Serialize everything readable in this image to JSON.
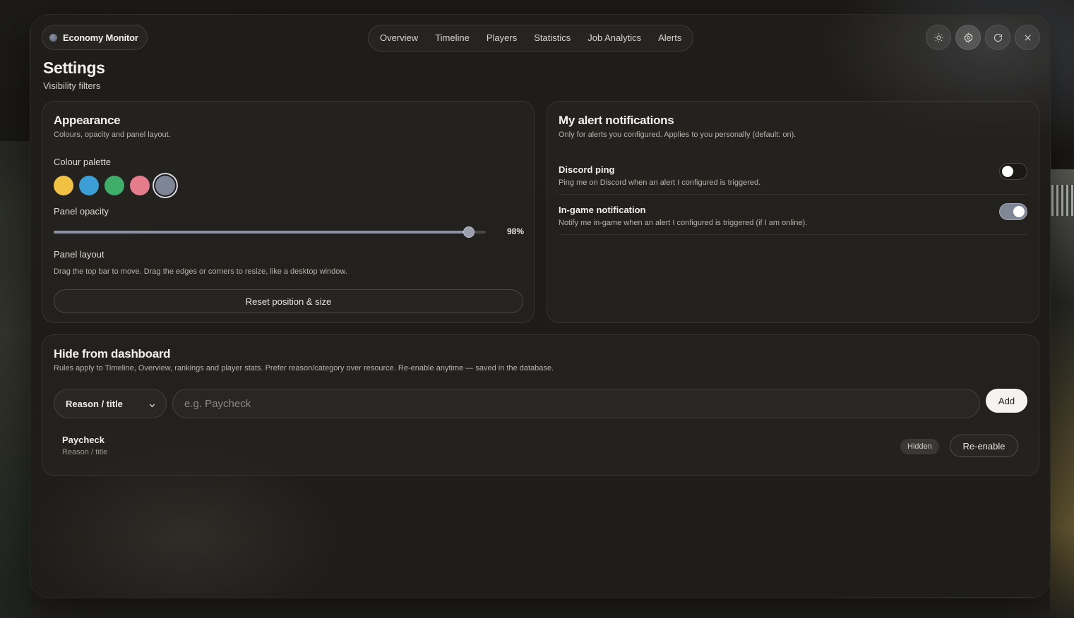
{
  "brand": {
    "label": "Economy Monitor"
  },
  "nav": {
    "tabs": [
      {
        "label": "Overview"
      },
      {
        "label": "Timeline"
      },
      {
        "label": "Players"
      },
      {
        "label": "Statistics"
      },
      {
        "label": "Job Analytics"
      },
      {
        "label": "Alerts"
      }
    ]
  },
  "toolbar": {
    "icons": [
      "sun-icon",
      "gear-icon",
      "refresh-icon",
      "close-icon"
    ],
    "active": "gear-icon"
  },
  "page": {
    "title": "Settings",
    "subtitle": "Visibility filters"
  },
  "appearance": {
    "title": "Appearance",
    "description": "Colours, opacity and panel layout.",
    "palette_label": "Colour palette",
    "palette": [
      {
        "color": "#f0c143",
        "selected": false
      },
      {
        "color": "#3b9fd6",
        "selected": false
      },
      {
        "color": "#3fae6a",
        "selected": false
      },
      {
        "color": "#e47c8c",
        "selected": false
      },
      {
        "color": "#7d8597",
        "selected": true
      }
    ],
    "opacity_label": "Panel opacity",
    "opacity_value": 98,
    "opacity_text": "98%",
    "layout_label": "Panel layout",
    "layout_description": "Drag the top bar to move. Drag the edges or corners to resize, like a desktop window.",
    "reset_label": "Reset position & size"
  },
  "alerts": {
    "title": "My alert notifications",
    "description": "Only for alerts you configured. Applies to you personally (default: on).",
    "items": [
      {
        "title": "Discord ping",
        "description": "Ping me on Discord when an alert I configured is triggered.",
        "enabled": false
      },
      {
        "title": "In-game notification",
        "description": "Notify me in-game when an alert I configured is triggered (if I am online).",
        "enabled": true
      }
    ]
  },
  "hide": {
    "title": "Hide from dashboard",
    "description": "Rules apply to Timeline, Overview, rankings and player stats. Prefer reason/category over resource. Re-enable anytime — saved in the database.",
    "select_value": "Reason / title",
    "input_placeholder": "e.g. Paycheck",
    "add_label": "Add",
    "rules": [
      {
        "title": "Paycheck",
        "type": "Reason / title",
        "status": "Hidden",
        "action_label": "Re-enable"
      }
    ]
  },
  "colors": {
    "accent": "#7d8597",
    "window_bg": "#1e1d1a"
  }
}
